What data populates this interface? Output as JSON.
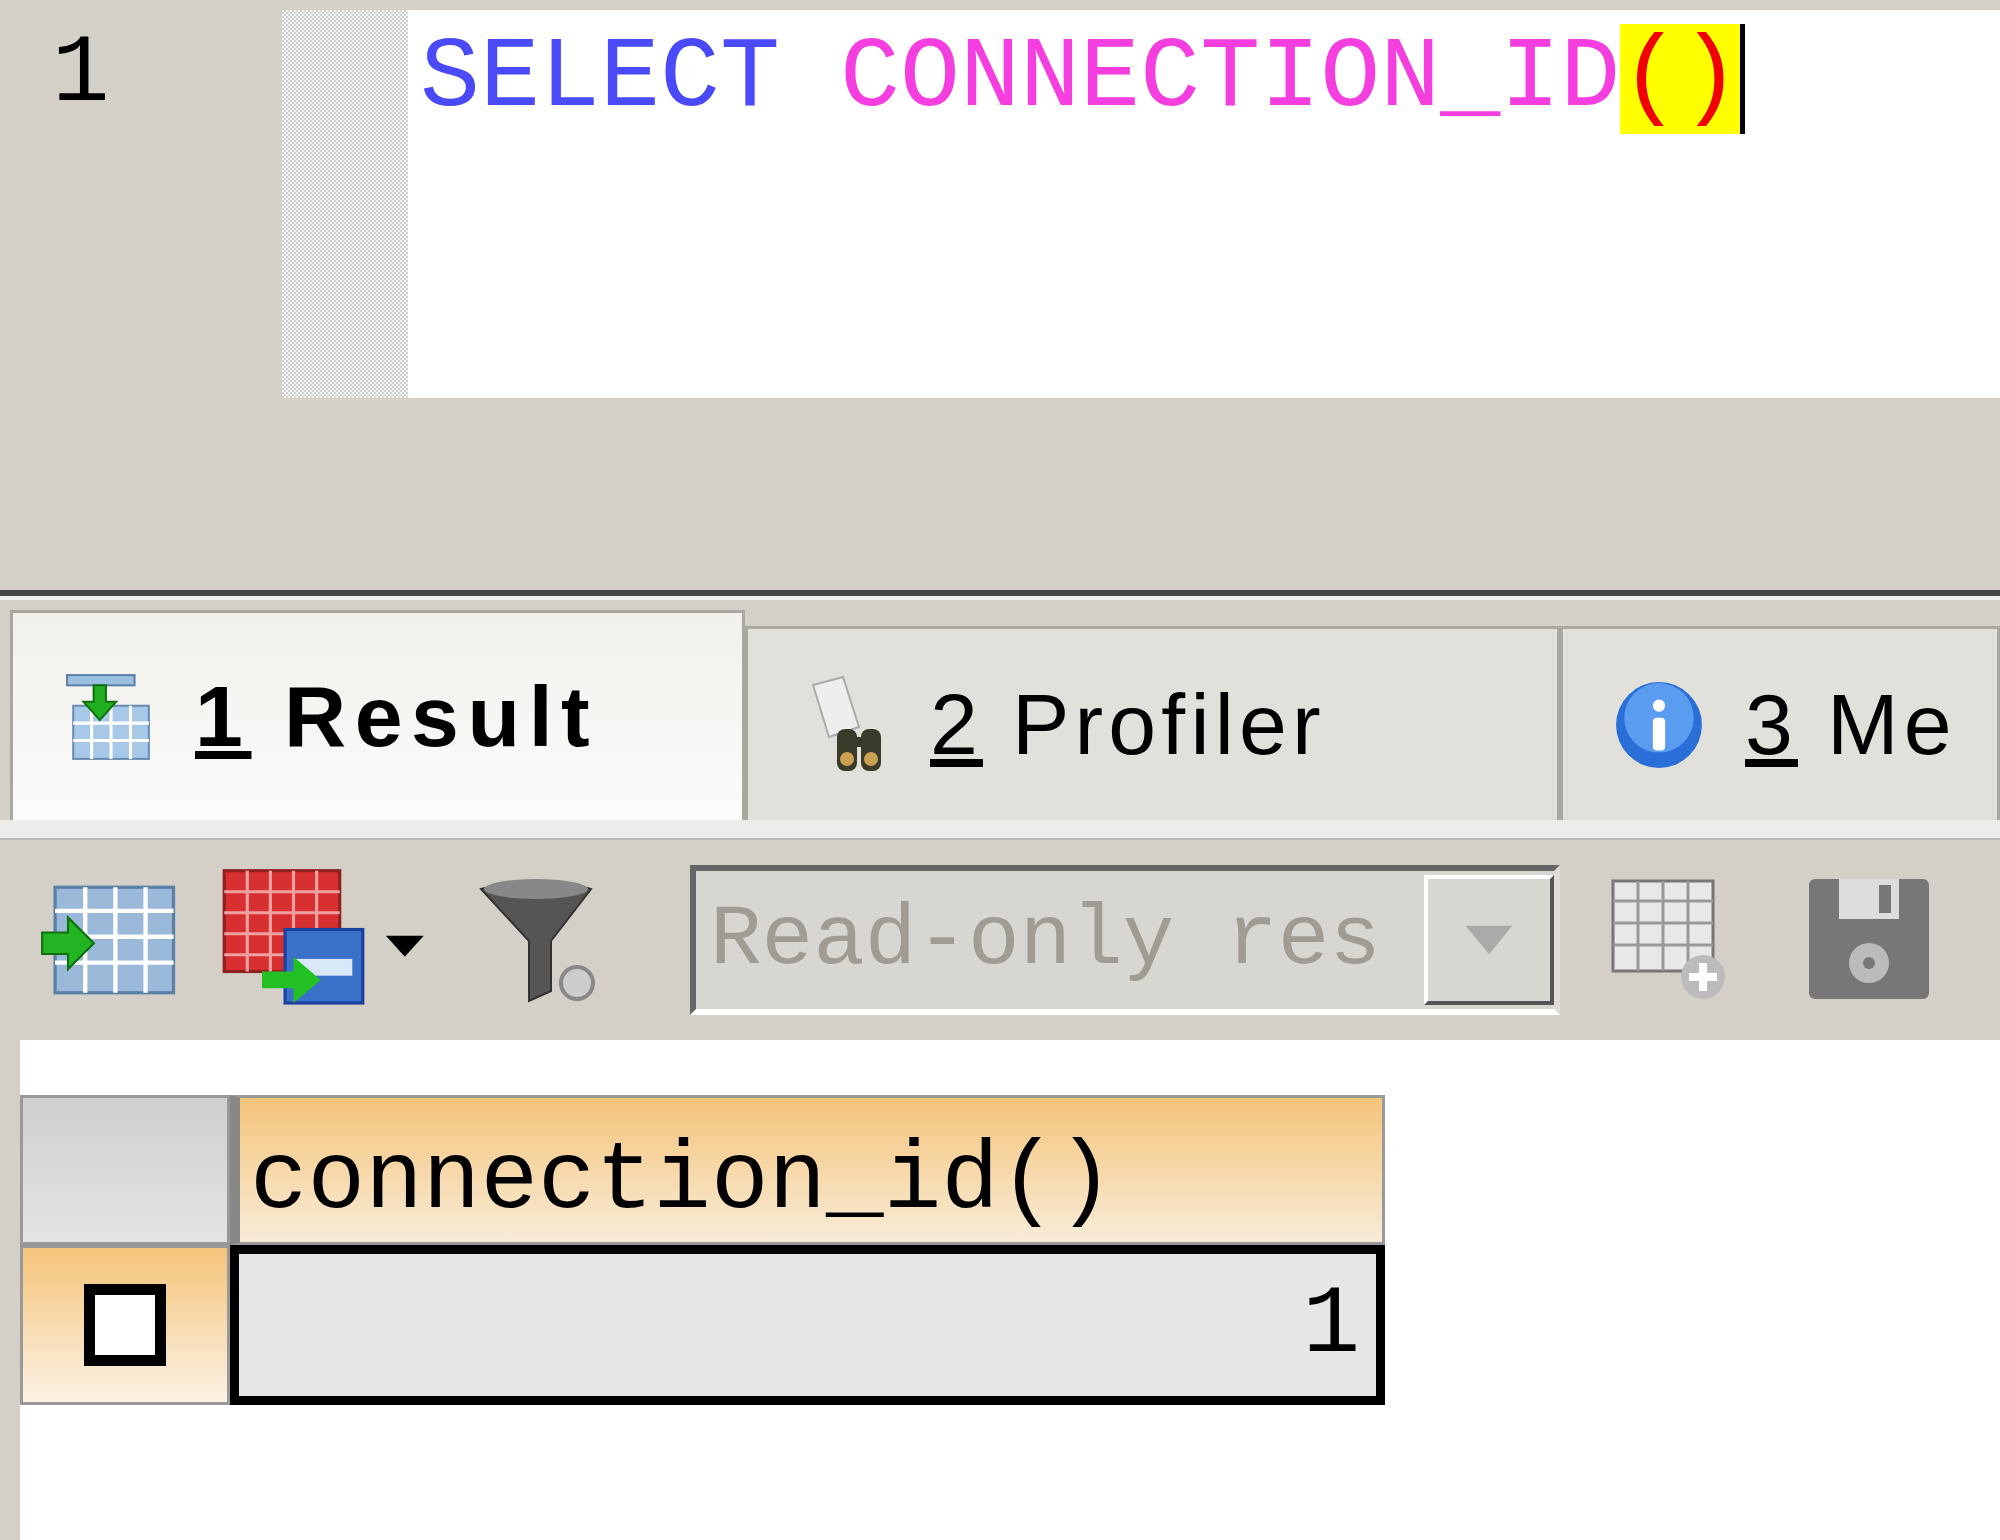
{
  "editor": {
    "line_numbers": [
      "1"
    ],
    "lines": [
      {
        "tokens": [
          {
            "text": "SELECT",
            "kind": "keyword",
            "matched": false
          },
          {
            "text": " CONNECTION_ID",
            "kind": "function",
            "matched": false
          },
          {
            "text": "()",
            "kind": "bracket",
            "matched": true
          }
        ]
      }
    ],
    "caret": true
  },
  "result_tabs": [
    {
      "number": "1",
      "label": "Result",
      "selected": true,
      "kind": "result"
    },
    {
      "number": "2",
      "label": "Profiler",
      "selected": false,
      "kind": "profiler"
    },
    {
      "number": "3",
      "label": "Me",
      "selected": false,
      "kind": "info"
    }
  ],
  "toolbar": {
    "mode_dropdown": {
      "value": "Read-only res",
      "disabled": true
    }
  },
  "grid": {
    "columns": [
      "connection_id()"
    ],
    "rows": [
      {
        "checked": false,
        "selected": true,
        "cells": [
          "1"
        ]
      }
    ]
  }
}
